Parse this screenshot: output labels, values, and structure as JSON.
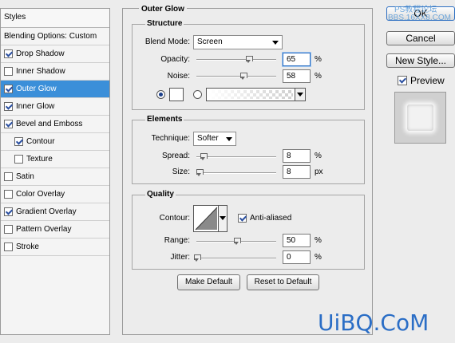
{
  "styles_panel": {
    "header": "Styles",
    "items": [
      {
        "label": "Blending Options: Custom",
        "checkbox": false,
        "checked": false,
        "selected": false,
        "sub": false
      },
      {
        "label": "Drop Shadow",
        "checkbox": true,
        "checked": true,
        "selected": false,
        "sub": false
      },
      {
        "label": "Inner Shadow",
        "checkbox": true,
        "checked": false,
        "selected": false,
        "sub": false
      },
      {
        "label": "Outer Glow",
        "checkbox": true,
        "checked": true,
        "selected": true,
        "sub": false
      },
      {
        "label": "Inner Glow",
        "checkbox": true,
        "checked": true,
        "selected": false,
        "sub": false
      },
      {
        "label": "Bevel and Emboss",
        "checkbox": true,
        "checked": true,
        "selected": false,
        "sub": false
      },
      {
        "label": "Contour",
        "checkbox": true,
        "checked": true,
        "selected": false,
        "sub": true
      },
      {
        "label": "Texture",
        "checkbox": true,
        "checked": false,
        "selected": false,
        "sub": true
      },
      {
        "label": "Satin",
        "checkbox": true,
        "checked": false,
        "selected": false,
        "sub": false
      },
      {
        "label": "Color Overlay",
        "checkbox": true,
        "checked": false,
        "selected": false,
        "sub": false
      },
      {
        "label": "Gradient Overlay",
        "checkbox": true,
        "checked": true,
        "selected": false,
        "sub": false
      },
      {
        "label": "Pattern Overlay",
        "checkbox": true,
        "checked": false,
        "selected": false,
        "sub": false
      },
      {
        "label": "Stroke",
        "checkbox": true,
        "checked": false,
        "selected": false,
        "sub": false
      }
    ]
  },
  "outer_glow": {
    "title": "Outer Glow",
    "structure": {
      "title": "Structure",
      "blend_mode_label": "Blend Mode:",
      "blend_mode_value": "Screen",
      "opacity_label": "Opacity:",
      "opacity_value": "65",
      "opacity_pct": 65,
      "noise_label": "Noise:",
      "noise_value": "58",
      "noise_pct": 58,
      "unit_percent": "%",
      "color_radio_selected": true,
      "glow_color": "#ffffff"
    },
    "elements": {
      "title": "Elements",
      "technique_label": "Technique:",
      "technique_value": "Softer",
      "spread_label": "Spread:",
      "spread_value": "8",
      "spread_pct": 8,
      "spread_unit": "%",
      "size_label": "Size:",
      "size_value": "8",
      "size_pct": 3,
      "size_unit": "px"
    },
    "quality": {
      "title": "Quality",
      "contour_label": "Contour:",
      "anti_aliased_label": "Anti-aliased",
      "anti_aliased_checked": true,
      "range_label": "Range:",
      "range_value": "50",
      "range_pct": 50,
      "range_unit": "%",
      "jitter_label": "Jitter:",
      "jitter_value": "0",
      "jitter_pct": 0,
      "jitter_unit": "%"
    },
    "make_default_label": "Make Default",
    "reset_default_label": "Reset to Default"
  },
  "buttons": {
    "ok_label": "OK",
    "cancel_label": "Cancel",
    "new_style_label": "New Style...",
    "preview_label": "Preview",
    "preview_checked": true
  },
  "watermark": {
    "text": "UiBQ.CoM",
    "top_text_1": "PS教程论坛",
    "top_text_2": "BBS.16XX8.COM"
  },
  "colors": {
    "selection": "#3b8fd9",
    "watermark": "#2b6ec6"
  }
}
